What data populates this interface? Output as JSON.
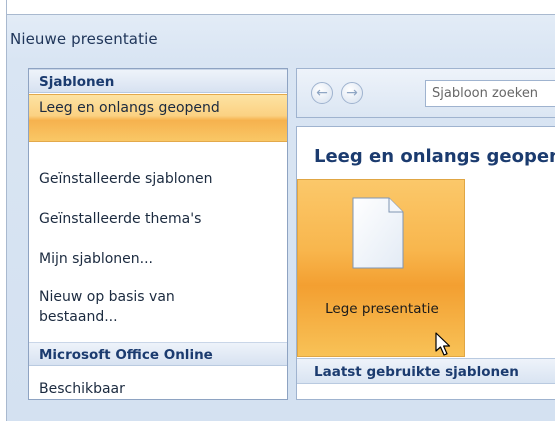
{
  "window": {
    "title": "Nieuwe presentatie"
  },
  "sidebar": {
    "sections": [
      {
        "header": "Sjablonen"
      },
      {
        "header": "Microsoft Office Online"
      }
    ],
    "items": [
      {
        "label": "Leeg en onlangs geopend",
        "selected": true
      },
      {
        "label": "Geïnstalleerde sjablonen"
      },
      {
        "label": "Geïnstalleerde thema's"
      },
      {
        "label": "Mijn sjablonen..."
      },
      {
        "label": "Nieuw op basis van bestaand..."
      },
      {
        "label": "Beschikbaar"
      }
    ]
  },
  "toolbar": {
    "back_icon": "arrow-left-icon",
    "forward_icon": "arrow-right-icon",
    "search_placeholder": "Sjabloon zoeken"
  },
  "main": {
    "heading": "Leeg en onlangs geopend",
    "tiles": [
      {
        "label": "Lege presentatie",
        "icon": "blank-document-icon",
        "selected": true
      }
    ],
    "recent_header": "Laatst gebruikte sjablonen"
  },
  "colors": {
    "selection_orange": "#f8b64d",
    "header_text": "#1b3b6f",
    "pane_border": "#8ea3c2"
  }
}
